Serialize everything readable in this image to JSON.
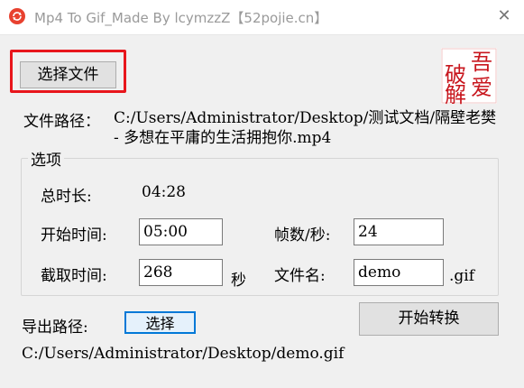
{
  "window": {
    "title": "Mp4 To Gif_Made By lcymzzZ【52pojie.cn】",
    "close_glyph": "✕"
  },
  "toolbar": {
    "select_file_label": "选择文件"
  },
  "seal": {
    "chars": [
      "吾",
      "破",
      "爱",
      "解"
    ],
    "color": "#c8161d"
  },
  "file": {
    "path_label": "文件路径：",
    "path_value": "C:/Users/Administrator/Desktop/测试文档/隔壁老樊 - 多想在平庸的生活拥抱你.mp4"
  },
  "options": {
    "group_label": "选项",
    "duration_label": "总时长:",
    "duration_value": "04:28",
    "start_label": "开始时间:",
    "start_value": "05:00",
    "fps_label": "帧数/秒:",
    "fps_value": "24",
    "clip_label": "截取时间:",
    "clip_value": "268",
    "clip_unit": "秒",
    "filename_label": "文件名:",
    "filename_value": "demo",
    "filename_ext": ".gif"
  },
  "export": {
    "label": "导出路径:",
    "select_label": "选择",
    "start_label": "开始转换",
    "path_value": "C:/Users/Administrator/Desktop/demo.gif"
  },
  "colors": {
    "highlight": "#e8161c",
    "focus": "#0078d7"
  }
}
